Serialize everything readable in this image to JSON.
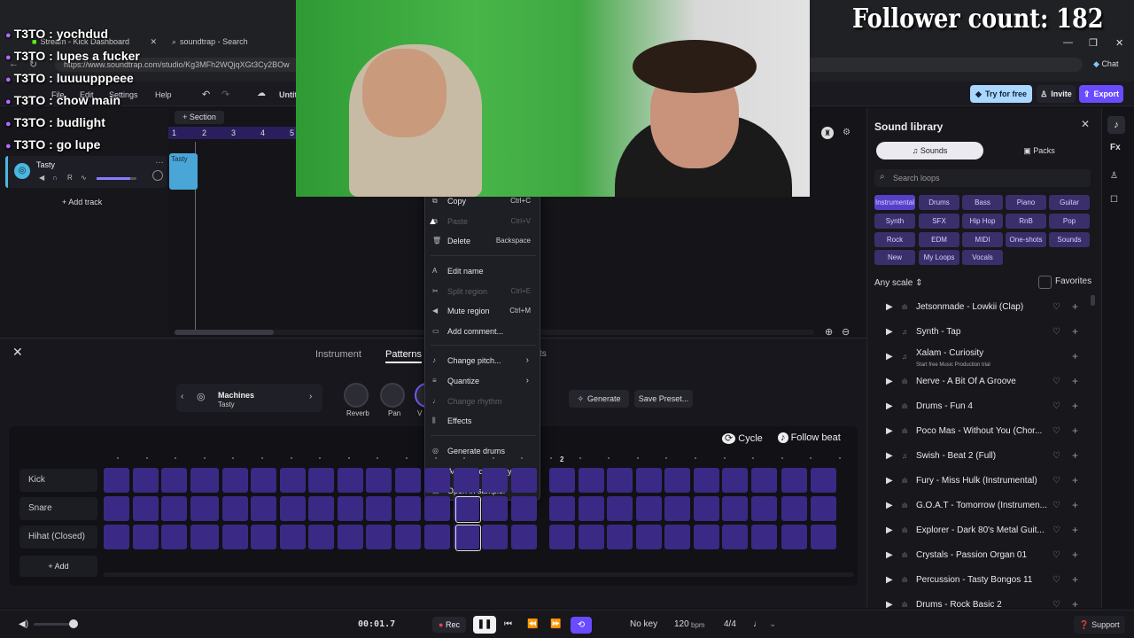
{
  "overlay": {
    "follower_count": "Follower count: 182",
    "chat": [
      {
        "user": "T3TO",
        "msg": "yochdud"
      },
      {
        "user": "T3TO",
        "msg": "lupes a fucker"
      },
      {
        "user": "T3TO",
        "msg": "luuuupppeee"
      },
      {
        "user": "T3TO",
        "msg": "chow main"
      },
      {
        "user": "T3TO",
        "msg": "budlight"
      },
      {
        "user": "T3TO",
        "msg": "go lupe"
      }
    ]
  },
  "browser": {
    "tabs": [
      "Stream - Kick Dashboard",
      "soundtrap - Search"
    ],
    "url": "https://www.soundtrap.com/studio/Kg3MFh2WQjqXGt3Cy2BOw",
    "chat_label": "Chat"
  },
  "app": {
    "menus": [
      "File",
      "Edit",
      "Settings",
      "Help"
    ],
    "project_name": "Untit",
    "try_free": "Try for free",
    "invite": "Invite",
    "export": "Export"
  },
  "arrange": {
    "section_label": "Section",
    "ruler": [
      "1",
      "2",
      "3",
      "4",
      "5"
    ],
    "track_name": "Tasty",
    "region_name": "Tasty",
    "add_track": "Add track",
    "track_rec": "R"
  },
  "editor": {
    "tabs": [
      "Instrument",
      "Patterns",
      "ts"
    ],
    "machine_title": "Machines",
    "machine_name": "Tasty",
    "knobs": [
      "Reverb",
      "Pan",
      "V"
    ],
    "generate": "Generate",
    "save_preset": "Save Preset...",
    "cycle": "Cycle",
    "follow_beat": "Follow beat",
    "bar_marker": "2",
    "rows": [
      "Kick",
      "Snare",
      "Hihat (Closed)"
    ],
    "add": "Add"
  },
  "context_menu": {
    "items": [
      {
        "label": "Copy",
        "shortcut": "Ctrl+C",
        "disabled": false
      },
      {
        "label": "Paste",
        "shortcut": "Ctrl+V",
        "disabled": true
      },
      {
        "label": "Delete",
        "shortcut": "Backspace",
        "disabled": false
      },
      {
        "label": "Edit name",
        "shortcut": "",
        "disabled": false
      },
      {
        "label": "Split region",
        "shortcut": "Ctrl+E",
        "disabled": true
      },
      {
        "label": "Mute region",
        "shortcut": "Ctrl+M",
        "disabled": false
      },
      {
        "label": "Add comment...",
        "shortcut": "",
        "disabled": false
      },
      {
        "label": "Change pitch...",
        "shortcut": "",
        "disabled": false
      },
      {
        "label": "Quantize",
        "shortcut": "",
        "disabled": false
      },
      {
        "label": "Change rhythm",
        "shortcut": "",
        "disabled": true
      },
      {
        "label": "Effects",
        "shortcut": "",
        "disabled": false
      },
      {
        "label": "Generate drums",
        "shortcut": "",
        "disabled": false
      },
      {
        "label": "Add to loop library...",
        "shortcut": "",
        "disabled": false
      },
      {
        "label": "Open in sampler",
        "shortcut": "",
        "disabled": false
      }
    ]
  },
  "library": {
    "title": "Sound library",
    "tab_sounds": "Sounds",
    "tab_packs": "Packs",
    "search_placeholder": "Search loops",
    "genres": [
      "Instrumental",
      "Drums",
      "Bass",
      "Piano",
      "Guitar",
      "Synth",
      "SFX",
      "Hip Hop",
      "RnB",
      "Pop",
      "Rock",
      "EDM",
      "MIDI",
      "One-shots",
      "Sounds",
      "New",
      "My Loops",
      "Vocals"
    ],
    "scale": "Any scale",
    "favorites": "Favorites",
    "items": [
      {
        "name": "Jetsonmade - Lowkii (Clap)",
        "sub": ""
      },
      {
        "name": "Synth - Tap",
        "sub": ""
      },
      {
        "name": "Xalam - Curiosity",
        "sub": "Start free Music Production trial"
      },
      {
        "name": "Nerve - A Bit Of A Groove",
        "sub": ""
      },
      {
        "name": "Drums - Fun 4",
        "sub": ""
      },
      {
        "name": "Poco Mas - Without You (Chor...",
        "sub": ""
      },
      {
        "name": "Swish - Beat 2 (Full)",
        "sub": ""
      },
      {
        "name": "Fury - Miss Hulk (Instrumental)",
        "sub": ""
      },
      {
        "name": "G.O.A.T - Tomorrow (Instrumen...",
        "sub": ""
      },
      {
        "name": "Explorer - Dark 80's Metal Guit...",
        "sub": ""
      },
      {
        "name": "Crystals - Passion Organ 01",
        "sub": ""
      },
      {
        "name": "Percussion - Tasty Bongos 11",
        "sub": ""
      },
      {
        "name": "Drums - Rock Basic 2",
        "sub": ""
      }
    ]
  },
  "rail": {
    "fx": "Fx"
  },
  "transport": {
    "time": "00:01.7",
    "rec": "Rec",
    "key": "No key",
    "bpm": "120",
    "bpm_unit": "bpm",
    "signature": "4/4",
    "support": "Support"
  },
  "colors": {
    "accent": "#7b5cff",
    "cell": "#3a2a86",
    "region": "#4aa6d6",
    "try_free": "#a9d7ff",
    "export": "#6b4bff"
  }
}
